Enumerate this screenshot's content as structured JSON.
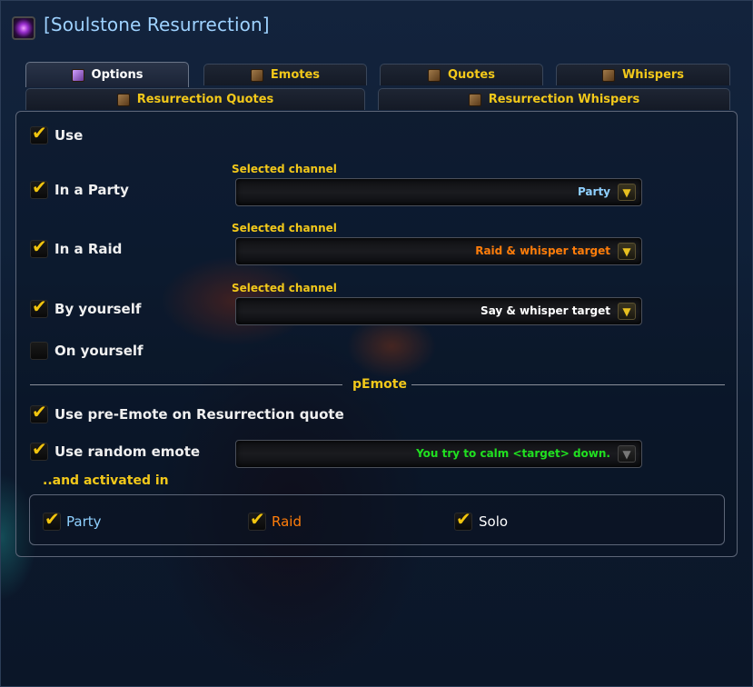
{
  "header": {
    "title": "[Soulstone Resurrection]",
    "icon": "soulstone-icon"
  },
  "tabs": [
    {
      "label": "Options",
      "active": true
    },
    {
      "label": "Emotes"
    },
    {
      "label": "Quotes"
    },
    {
      "label": "Whispers"
    },
    {
      "label": "Resurrection Quotes"
    },
    {
      "label": "Resurrection Whispers"
    }
  ],
  "options": {
    "use": {
      "label": "Use",
      "checked": true
    },
    "party": {
      "label": "In a Party",
      "checked": true,
      "channel_label": "Selected channel",
      "channel": "Party",
      "channel_color": "#8fd0ff"
    },
    "raid": {
      "label": "In a Raid",
      "checked": true,
      "channel_label": "Selected channel",
      "channel": "Raid & whisper target",
      "channel_color": "#ff7d0a"
    },
    "self": {
      "label": "By yourself",
      "checked": true,
      "channel_label": "Selected channel",
      "channel": "Say & whisper target",
      "channel_color": "#ffffff"
    },
    "on_self": {
      "label": "On yourself",
      "checked": false
    }
  },
  "pemote": {
    "separator": "pEmote",
    "pre_emote": {
      "label": "Use pre-Emote on Resurrection quote",
      "checked": true
    },
    "random_emote": {
      "label": "Use random emote",
      "checked": true,
      "value": "You try to calm <target> down.",
      "value_color": "#20e020"
    },
    "activated_label": "..and activated in",
    "contexts": [
      {
        "label": "Party",
        "checked": true,
        "color": "#8fd0ff"
      },
      {
        "label": "Raid",
        "checked": true,
        "color": "#ff7d0a"
      },
      {
        "label": "Solo",
        "checked": true,
        "color": "#ffffff"
      }
    ]
  },
  "colors": {
    "accent": "#f2c81a",
    "title": "#9ed2ff"
  }
}
